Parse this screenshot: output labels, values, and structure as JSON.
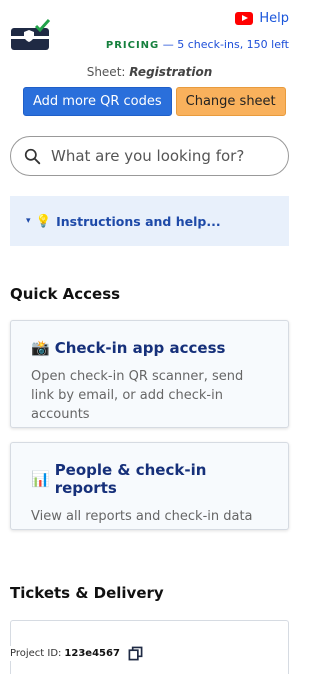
{
  "header": {
    "help_label": "Help",
    "pricing_label": "PRICING",
    "pricing_detail": "— 5 check-ins, 150 left",
    "sheet_prefix": "Sheet:",
    "sheet_name": "Registration"
  },
  "actions": {
    "add_qr_label": "Add more QR codes",
    "change_sheet_label": "Change sheet"
  },
  "search": {
    "placeholder": "What are you looking for?"
  },
  "instructions": {
    "label": "Instructions and help..."
  },
  "sections": {
    "quick_access": "Quick Access",
    "tickets_delivery": "Tickets & Delivery"
  },
  "cards": [
    {
      "emoji": "📸",
      "title": "Check-in app access",
      "description": "Open check-in QR scanner, send link by email, or add check-in accounts"
    },
    {
      "emoji": "📊",
      "title": "People & check-in reports",
      "description": "View all reports and check-in data"
    }
  ],
  "footer": {
    "project_label": "Project ID:",
    "project_id": "123e4567"
  },
  "colors": {
    "primary": "#2a6fdb",
    "secondary": "#f9b15c",
    "pricing": "#15803d",
    "link": "#1a56db"
  }
}
